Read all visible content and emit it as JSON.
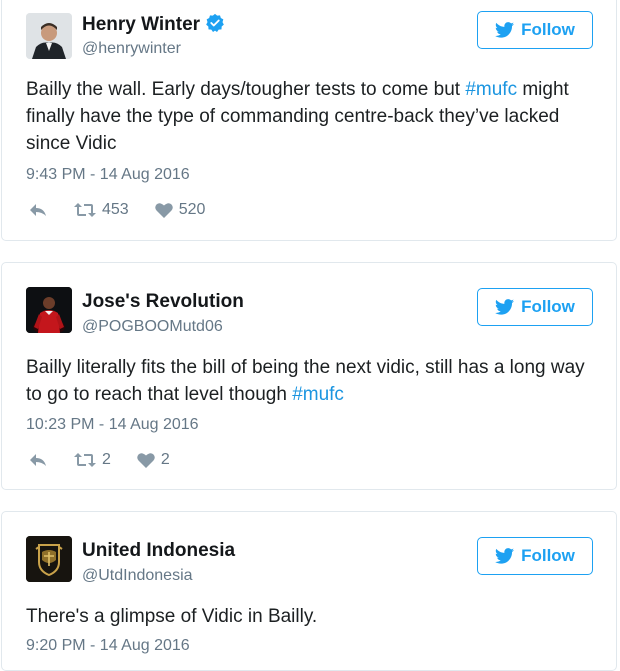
{
  "colors": {
    "accent": "#1da1f2",
    "hashtag": "#1b95e0",
    "muted": "#657786",
    "border": "#e1e8ed"
  },
  "tweets": [
    {
      "name": "Henry Winter",
      "handle": "@henrywinter",
      "verified": true,
      "follow_label": "Follow",
      "text_before": "Bailly the wall. Early days/tougher tests to come but ",
      "hashtag": "#mufc",
      "text_after": " might finally have the type of commanding centre-back they’ve lacked since Vidic",
      "timestamp": "9:43 PM - 14 Aug 2016",
      "retweets": "453",
      "likes": "520",
      "avatar_icon": "person-in-suit-icon"
    },
    {
      "name": "Jose's Revolution",
      "handle": "@POGBOOMutd06",
      "verified": false,
      "follow_label": "Follow",
      "text_before": "Bailly literally fits the bill of being the next vidic, still has a long way to go to reach that level though ",
      "hashtag": "#mufc",
      "text_after": "",
      "timestamp": "10:23 PM - 14 Aug 2016",
      "retweets": "2",
      "likes": "2",
      "avatar_icon": "red-footballer-icon"
    },
    {
      "name": "United Indonesia",
      "handle": "@UtdIndonesia",
      "verified": false,
      "follow_label": "Follow",
      "text_before": "There's a glimpse of Vidic in Bailly.",
      "hashtag": "",
      "text_after": "",
      "timestamp": "9:20 PM - 14 Aug 2016",
      "avatar_icon": "club-crest-icon"
    }
  ]
}
